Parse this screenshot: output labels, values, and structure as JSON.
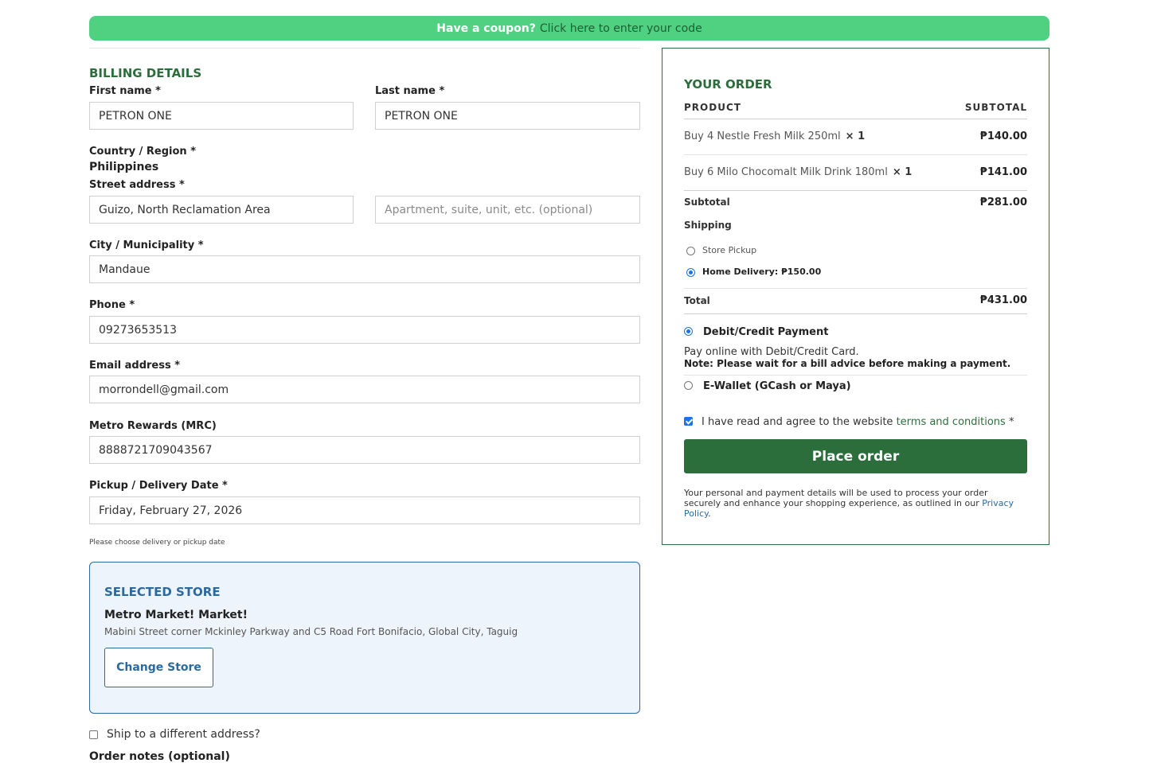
{
  "coupon": {
    "question": "Have a coupon?",
    "link": "Click here to enter your code"
  },
  "billing": {
    "title": "BILLING DETAILS",
    "first_name": {
      "label": "First name",
      "value": "PETRON ONE"
    },
    "last_name": {
      "label": "Last name",
      "value": "PETRON ONE"
    },
    "country": {
      "label": "Country / Region",
      "value": "Philippines"
    },
    "street": {
      "label": "Street address",
      "value": "Guizo, North Reclamation Area",
      "placeholder2": "Apartment, suite, unit, etc. (optional)"
    },
    "city": {
      "label": "City / Municipality",
      "value": "Mandaue"
    },
    "phone": {
      "label": "Phone",
      "value": "09273653513"
    },
    "email": {
      "label": "Email address",
      "value": "morrondell@gmail.com"
    },
    "mrc": {
      "label": "Metro Rewards (MRC)",
      "value": "8888721709043567"
    },
    "date": {
      "label": "Pickup / Delivery Date",
      "value": "Friday, February 27, 2026",
      "hint": "Please choose delivery or pickup date"
    },
    "required_mark": "*"
  },
  "store": {
    "title": "SELECTED STORE",
    "name": "Metro Market! Market!",
    "address": "Mabini Street corner Mckinley Parkway and C5 Road Fort Bonifacio, Global City, Taguig",
    "change_label": "Change Store"
  },
  "ship_different": {
    "label": "Ship to a different address?",
    "checked": false
  },
  "order_notes": {
    "label": "Order notes (optional)"
  },
  "order": {
    "title": "YOUR ORDER",
    "col_product": "PRODUCT",
    "col_subtotal": "SUBTOTAL",
    "items": [
      {
        "name": "Buy 4 Nestle Fresh Milk 250ml",
        "qty": "× 1",
        "price": "₱140.00"
      },
      {
        "name": "Buy 6 Milo Chocomalt Milk Drink 180ml",
        "qty": "× 1",
        "price": "₱141.00"
      }
    ],
    "subtotal_label": "Subtotal",
    "subtotal": "₱281.00",
    "shipping_label": "Shipping",
    "shipping_options": [
      {
        "label": "Store Pickup",
        "checked": false
      },
      {
        "label": "Home Delivery:",
        "price": "₱150.00",
        "checked": true
      }
    ],
    "total_label": "Total",
    "total": "₱431.00",
    "payment_options": [
      {
        "label": "Debit/Credit Payment",
        "checked": true
      },
      {
        "label": "E-Wallet (GCash or Maya)",
        "checked": false
      }
    ],
    "payment_desc": "Pay online with Debit/Credit Card.",
    "payment_note": "Note: Please wait for a bill advice before making a payment.",
    "terms_text": "I have read and agree to the website",
    "terms_link": "terms and conditions",
    "terms_req": "*",
    "place_order": "Place order",
    "privacy_text": "Your personal and payment details will be used to process your order securely and enhance your shopping experience, as outlined in our",
    "privacy_link": "Privacy Policy",
    "privacy_end": "."
  },
  "colors": {
    "accent_green": "#2b6e3c",
    "coupon_green": "#4fd181",
    "store_blue": "#2a6aa1",
    "radio_blue": "#1a73e8"
  }
}
